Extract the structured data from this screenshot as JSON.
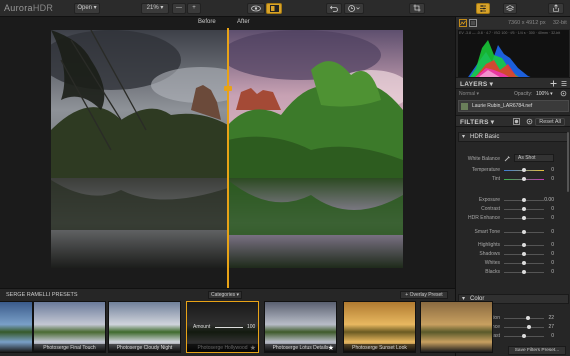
{
  "app": {
    "logo_a": "Aurora",
    "logo_b": "HDR"
  },
  "toolbar": {
    "open": "Open ▾",
    "zoom": "21% ▾",
    "minus": "—",
    "plus": "+",
    "img_info_size": "7360 x 4912 px",
    "img_info_bits": "32-bit"
  },
  "compare": {
    "before": "Before",
    "after": "After"
  },
  "histogram": {
    "info": "EV -3.8 — -0.8 · 4.7 · ISO 100 · f/5 · 1/4 s · 300 · 40mm · 32-bit"
  },
  "layers": {
    "title": "LAYERS ▾",
    "mode": "Normal ▾",
    "opacity_label": "Opacity:",
    "opacity_value": "100% ▾",
    "layer_name": "Laurie Rubin_LAR6784.nef"
  },
  "filters": {
    "title": "FILTERS ▾",
    "reset": "Reset All"
  },
  "hdr_basic": {
    "title": "HDR Basic",
    "white_balance_label": "White Balance",
    "white_balance_value": "As Shot",
    "rows": [
      {
        "label": "Temperature",
        "value": "0",
        "pos": 0.5,
        "color": "temp"
      },
      {
        "label": "Tint",
        "value": "0",
        "pos": 0.5,
        "color": "tint"
      },
      {
        "label": "Exposure",
        "value": "0.00",
        "pos": 0.5
      },
      {
        "label": "Contrast",
        "value": "0",
        "pos": 0.5
      },
      {
        "label": "HDR Enhance",
        "value": "0",
        "pos": 0.5
      },
      {
        "label": "Smart Tone",
        "value": "0",
        "pos": 0.5
      },
      {
        "label": "Highlights",
        "value": "0",
        "pos": 0.5
      },
      {
        "label": "Shadows",
        "value": "0",
        "pos": 0.5
      },
      {
        "label": "Whites",
        "value": "0",
        "pos": 0.5
      },
      {
        "label": "Blacks",
        "value": "0",
        "pos": 0.5
      }
    ]
  },
  "color": {
    "title": "Color",
    "rows": [
      {
        "label": "Saturation",
        "value": "22",
        "pos": 0.61
      },
      {
        "label": "Vibrance",
        "value": "27",
        "pos": 0.63
      },
      {
        "label": "Color Contrast",
        "value": "0",
        "pos": 0.5
      }
    ]
  },
  "presets": {
    "header": "SERGE RAMELLI PRESETS",
    "categories": "Categories ▾",
    "overlay": "+ Overlay Preset",
    "save": "Save Filters Preset...",
    "amount_label": "Amount",
    "amount_value": "100",
    "items": [
      "",
      "Photoserge Final Touch",
      "Photoserge Cloudy Night",
      "Photoserge Hollywood",
      "Photoserge Lotus Details",
      "Photoserge Sunset Look",
      ""
    ]
  },
  "colors": {
    "accent": "#e8a317"
  }
}
